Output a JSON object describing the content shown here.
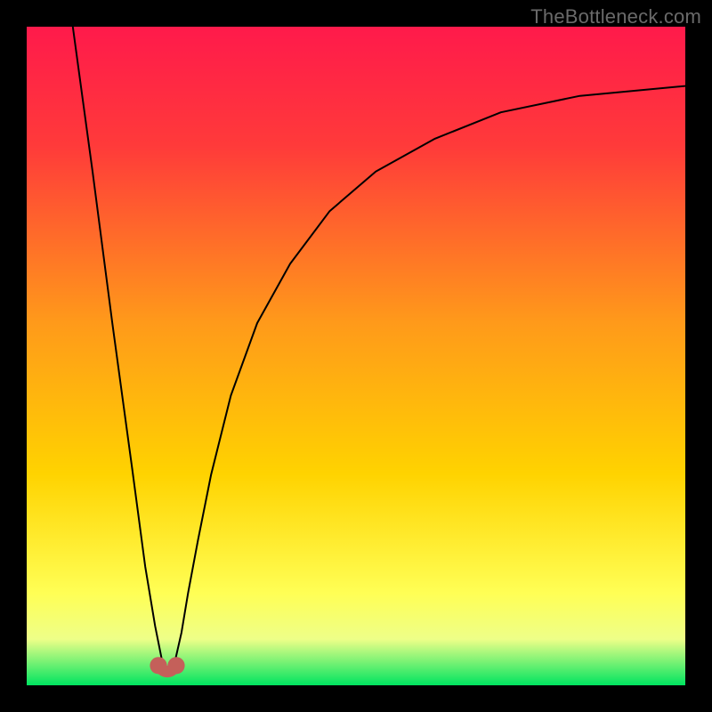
{
  "watermark": "TheBottleneck.com",
  "chart_data": {
    "type": "line",
    "title": "",
    "xlabel": "",
    "ylabel": "",
    "xlim": [
      0,
      100
    ],
    "ylim": [
      0,
      100
    ],
    "grid": false,
    "legend": false,
    "background_gradient": {
      "top_color": "#ff1a4b",
      "mid_color": "#ffd300",
      "bottom_color": "#00e460"
    },
    "series": [
      {
        "name": "curve",
        "x": [
          7,
          10,
          13,
          16,
          18,
          19.5,
          20.5,
          21,
          21.8,
          22.6,
          23.5,
          24.5,
          26,
          28,
          31,
          35,
          40,
          46,
          53,
          62,
          72,
          84,
          100
        ],
        "y": [
          100,
          78,
          55,
          33,
          18,
          9,
          4,
          2,
          2,
          4,
          8,
          14,
          22,
          32,
          44,
          55,
          64,
          72,
          78,
          83,
          87,
          89.5,
          91
        ]
      }
    ],
    "markers": [
      {
        "name": "min-left",
        "x": 20.0,
        "y": 3.0,
        "color": "#c4605a",
        "r": 1.3
      },
      {
        "name": "min-right",
        "x": 22.7,
        "y": 3.0,
        "color": "#c4605a",
        "r": 1.3
      }
    ],
    "marker_connector": {
      "from": 0,
      "to": 1,
      "color": "#c4605a",
      "width": 1.8,
      "y": 2.0
    }
  }
}
